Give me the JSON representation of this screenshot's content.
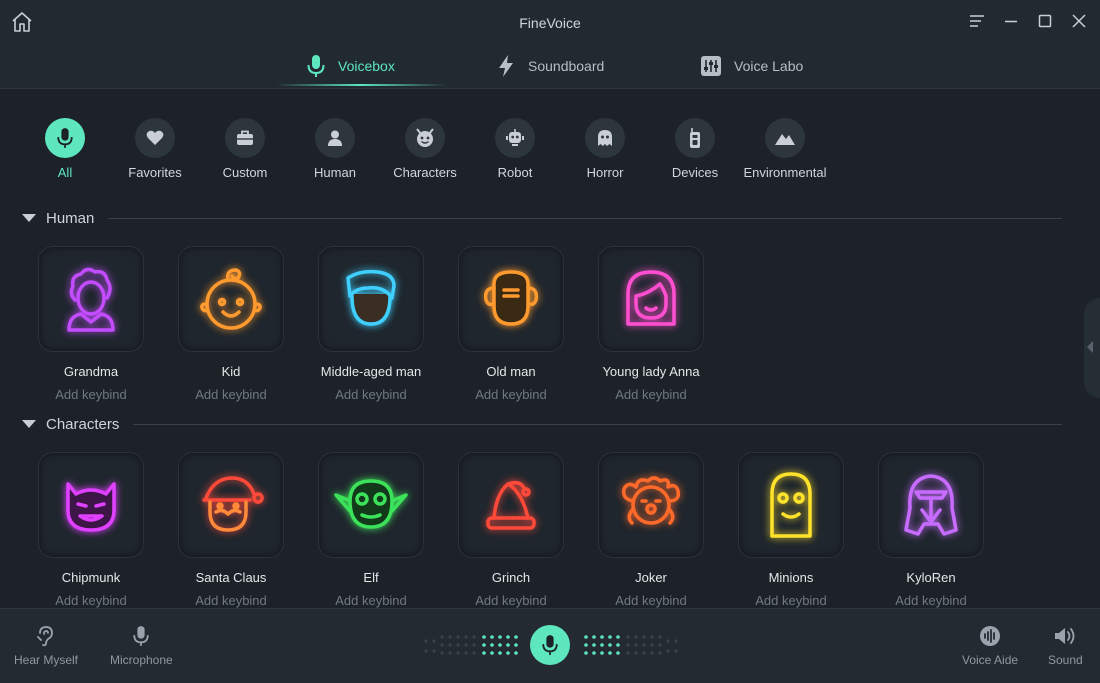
{
  "app": {
    "title": "FineVoice"
  },
  "tabs": [
    {
      "label": "Voicebox",
      "icon": "mic-icon",
      "active": true
    },
    {
      "label": "Soundboard",
      "icon": "lightning-icon",
      "active": false
    },
    {
      "label": "Voice Labo",
      "icon": "sliders-icon",
      "active": false
    }
  ],
  "categories": [
    {
      "label": "All",
      "icon": "mic-icon",
      "active": true
    },
    {
      "label": "Favorites",
      "icon": "heart-icon"
    },
    {
      "label": "Custom",
      "icon": "briefcase-icon"
    },
    {
      "label": "Human",
      "icon": "person-icon"
    },
    {
      "label": "Characters",
      "icon": "devil-icon"
    },
    {
      "label": "Robot",
      "icon": "robot-icon"
    },
    {
      "label": "Horror",
      "icon": "ghost-icon"
    },
    {
      "label": "Devices",
      "icon": "walkie-talkie-icon"
    },
    {
      "label": "Environmental",
      "icon": "mountain-icon"
    }
  ],
  "sections": [
    {
      "title": "Human",
      "voices": [
        {
          "name": "Grandma",
          "keybind": "Add keybind",
          "color": "#c34cff"
        },
        {
          "name": "Kid",
          "keybind": "Add keybind",
          "color": "#ff9a2e"
        },
        {
          "name": "Middle-aged man",
          "keybind": "Add keybind",
          "color": "#3fd0ff"
        },
        {
          "name": "Old man",
          "keybind": "Add keybind",
          "color": "#ff9a2e"
        },
        {
          "name": "Young lady Anna",
          "keybind": "Add keybind",
          "color": "#ff4fd0"
        }
      ]
    },
    {
      "title": "Characters",
      "voices": [
        {
          "name": "Chipmunk",
          "keybind": "Add keybind",
          "color": "#e040ff"
        },
        {
          "name": "Santa Claus",
          "keybind": "Add keybind",
          "color": "#ff4a3a"
        },
        {
          "name": "Elf",
          "keybind": "Add keybind",
          "color": "#3ce25a"
        },
        {
          "name": "Grinch",
          "keybind": "Add keybind",
          "color": "#ff4a3a"
        },
        {
          "name": "Joker",
          "keybind": "Add keybind",
          "color": "#ff6a2a"
        },
        {
          "name": "Minions",
          "keybind": "Add keybind",
          "color": "#ffe22a"
        },
        {
          "name": "KyloRen",
          "keybind": "Add keybind",
          "color": "#c86cff"
        }
      ]
    }
  ],
  "bottom": {
    "hear_myself": "Hear Myself",
    "microphone": "Microphone",
    "voice_aide": "Voice Aide",
    "sound": "Sound"
  },
  "colors": {
    "accent": "#5ee6bf",
    "background": "#1c2228"
  }
}
